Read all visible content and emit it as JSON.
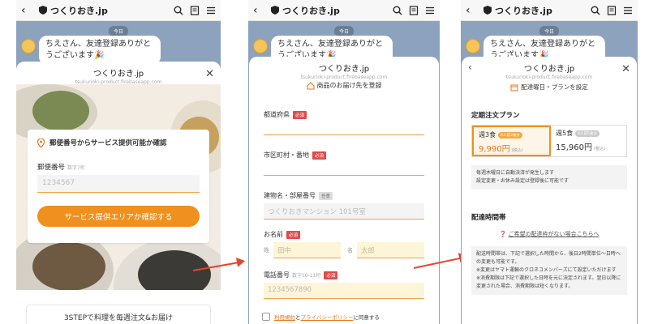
{
  "app": {
    "title": "つくりおき.jp"
  },
  "chat": {
    "day": "今日",
    "message": "ちえさん、友達登録ありがとうございます🎉"
  },
  "screen1": {
    "sheet_title": "つくりおき.jp",
    "sheet_url": "tsukurioki-product.firebaseapp.com",
    "card_title": "郵便番号からサービス提供可能か確認",
    "postal_label": "郵便番号",
    "postal_hint": "数字7桁",
    "postal_placeholder": "1234567",
    "check_button": "サービス提供エリアか確認する",
    "step_text": "3STEPで料理を毎週注文&お届け"
  },
  "screen2": {
    "sheet_title": "つくりおき.jp",
    "sheet_url": "tsukurioki-product.firebaseapp.com",
    "heading": "商品のお届け先を登録",
    "pref_label": "都道府県",
    "city_label": "市区町村・番地",
    "building_label": "建物名・部屋番号",
    "building_placeholder": "つくりおきマンション 101号室",
    "name_label": "お名前",
    "last_label": "姓",
    "last_placeholder": "田中",
    "first_label": "名",
    "first_placeholder": "太郎",
    "phone_label": "電話番号",
    "phone_hint": "数字10-11桁",
    "phone_placeholder": "1234567890",
    "required": "必須",
    "optional": "任意",
    "terms_link": "利用規約",
    "and": "と",
    "privacy_link": "プライバシーポリシー",
    "agree_suffix": "に同意する"
  },
  "screen3": {
    "sheet_title": "つくりおき.jp",
    "sheet_url": "tsukurioki-product.firebaseapp.com",
    "heading": "配達曜日・プランを設定",
    "plan_section": "定期注文プラン",
    "plans": [
      {
        "name": "週3食",
        "tag": "4人前3食分",
        "price": "9,990円",
        "tax": "(税込)",
        "selected": true
      },
      {
        "name": "週5食",
        "tag": "4人前5食分",
        "price": "15,960円",
        "tax": "(税込)",
        "selected": false
      }
    ],
    "plan_note": "毎週木曜日に自動決済が発生します\n設定変更・お休み設定は登録後に可能です",
    "time_section": "配達時間帯",
    "wish_link": "ご希望の配達枠がない場合こちらへ",
    "time_note": "配送時間帯は、下記で選択した時間から、後日2時間単位〜日時への変更も可能です。\n※変更はヤマト運輸のクロネコメンバーズにて設定いただけます\n※消費期限は下記で選択した日時を元に決定されます。翌日以降に変更された場合、消費期限は短くなります。"
  },
  "colors": {
    "accent": "#f0901e",
    "required": "#e14a4a",
    "arrow": "#e8432a",
    "chat_bg": "#8ca2bd"
  }
}
